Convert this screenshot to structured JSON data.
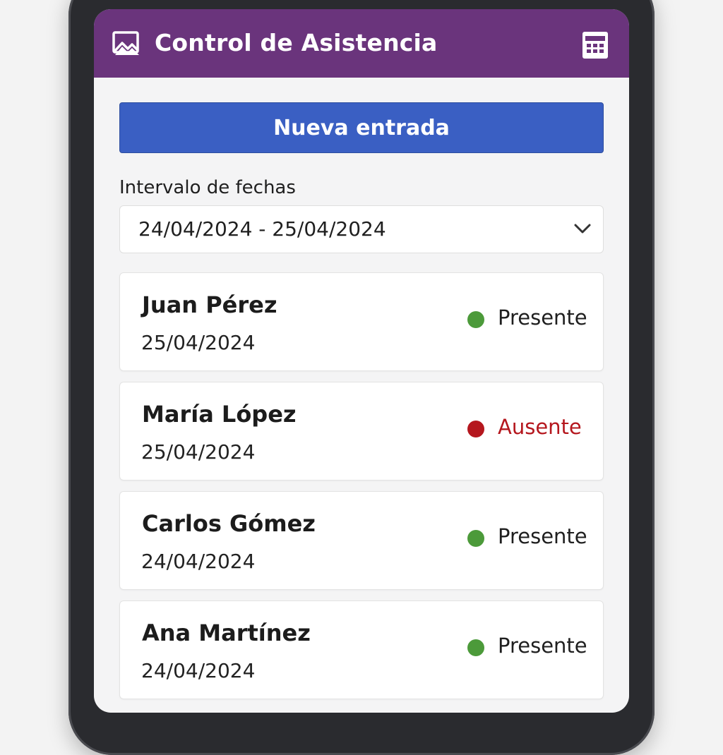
{
  "header": {
    "title": "Control de Asistencia",
    "logo_icon": "image-icon",
    "calendar_icon": "calendar-icon"
  },
  "actions": {
    "new_entry_label": "Nueva entrada"
  },
  "filter": {
    "label": "Intervalo de fechas",
    "value": "24/04/2024 - 25/04/2024"
  },
  "colors": {
    "header": "#6a347c",
    "primary_button": "#3a5fc3",
    "present": "#4c9a3a",
    "absent": "#b5171e"
  },
  "records": [
    {
      "name": "Juan Pérez",
      "date": "25/04/2024",
      "status": "Presente",
      "status_color": "#4c9a3a",
      "text_color": "#1f1f1f"
    },
    {
      "name": "María López",
      "date": "25/04/2024",
      "status": "Ausente",
      "status_color": "#b5171e",
      "text_color": "#b5171e"
    },
    {
      "name": "Carlos Gómez",
      "date": "24/04/2024",
      "status": "Presente",
      "status_color": "#4c9a3a",
      "text_color": "#1f1f1f"
    },
    {
      "name": "Ana Martínez",
      "date": "24/04/2024",
      "status": "Presente",
      "status_color": "#4c9a3a",
      "text_color": "#1f1f1f"
    }
  ]
}
